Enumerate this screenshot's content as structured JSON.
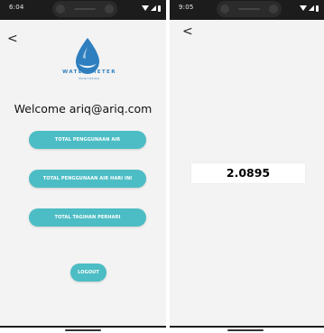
{
  "left_screen": {
    "status_time": "6:04",
    "back_label": "<",
    "logo": {
      "title": "WATER METER",
      "subtitle": "MONITORING",
      "color": "#2e7fbf"
    },
    "welcome": "Welcome ariq@ariq.com",
    "buttons": {
      "total": "TOTAL PENGGUNAAN AIR",
      "hari_ini": "TOTAL PENGGUNAAN AIR HARI INI",
      "tagihan": "TOTAL TAGIHAN PERHARI",
      "logout": "LOGOUT"
    },
    "button_color": "#4cbdc4"
  },
  "right_screen": {
    "status_time": "9:05",
    "back_label": "<",
    "value": "2.0895"
  },
  "icons": {
    "status": [
      "wifi-icon",
      "signal-icon",
      "battery-icon"
    ],
    "logo": "water-drop-icon"
  }
}
